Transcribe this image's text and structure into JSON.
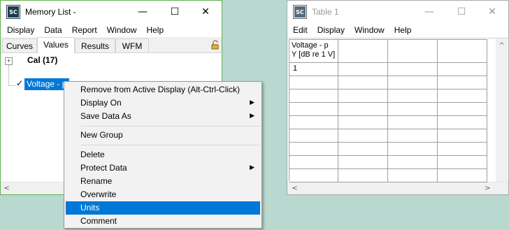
{
  "memory_window": {
    "icon_text": "SC",
    "title": "Memory List -",
    "controls": {
      "minimize": "—",
      "maximize": "☐",
      "close": "✕"
    },
    "menu": [
      "Display",
      "Data",
      "Report",
      "Window",
      "Help"
    ],
    "tabs": [
      "Curves",
      "Values",
      "Results",
      "WFM"
    ],
    "active_tab": "Values",
    "tree": {
      "group_expander": "+",
      "group_label": "Cal (17)",
      "item_check": "✓",
      "item_label": "Voltage - p"
    },
    "scroll_left": "<"
  },
  "context_menu": {
    "items": [
      {
        "label": "Remove from Active Display (Alt-Ctrl-Click)",
        "submenu": false
      },
      {
        "label": "Display On",
        "submenu": true
      },
      {
        "label": "Save Data As",
        "submenu": true
      },
      {
        "label": "New Group",
        "submenu": false
      },
      {
        "label": "Delete",
        "submenu": false
      },
      {
        "label": "Protect Data",
        "submenu": true
      },
      {
        "label": "Rename",
        "submenu": false
      },
      {
        "label": "Overwrite",
        "submenu": false
      },
      {
        "label": "Units",
        "submenu": false,
        "highlighted": true
      },
      {
        "label": "Comment",
        "submenu": false
      }
    ]
  },
  "table_window": {
    "icon_text": "SC",
    "title": "Table 1",
    "controls": {
      "minimize": "—",
      "maximize": "☐",
      "close": "✕"
    },
    "menu": [
      "Edit",
      "Display",
      "Window",
      "Help"
    ],
    "header_line1": "Voltage - p",
    "header_line2": "Y [dB re 1 V]",
    "first_cell": "1",
    "scroll_up": "^",
    "scroll_left": "<",
    "scroll_right": ">"
  },
  "colors": {
    "desktop": "#b8d8d0",
    "selection": "#0078d7",
    "active_frame": "#4caf50"
  }
}
